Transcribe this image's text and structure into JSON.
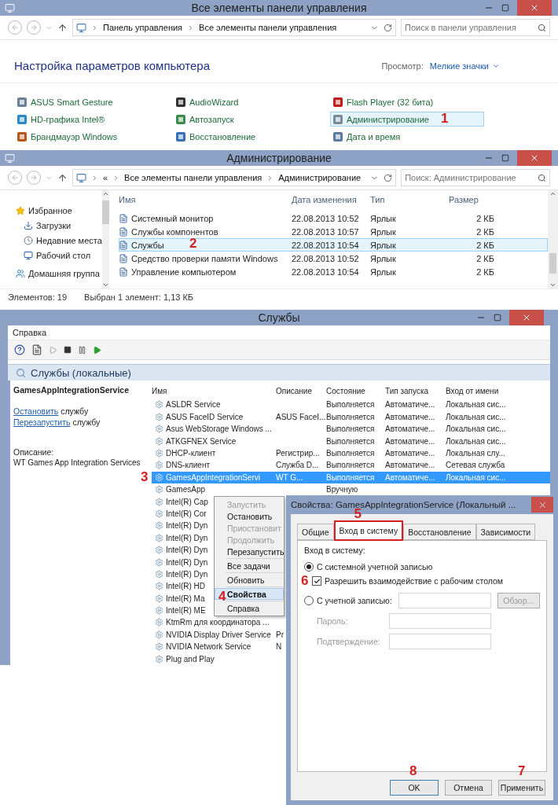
{
  "control_panel": {
    "title": "Все элементы панели управления",
    "breadcrumb": [
      "Панель управления",
      "Все элементы панели управления"
    ],
    "search_placeholder": "Поиск в панели управления",
    "heading": "Настройка параметров компьютера",
    "view_label": "Просмотр:",
    "view_value": "Мелкие значки",
    "items": [
      {
        "label": "ASUS Smart Gesture",
        "selected": false
      },
      {
        "label": "AudioWizard",
        "selected": false
      },
      {
        "label": "Flash Player (32 бита)",
        "selected": false
      },
      {
        "label": "HD-графика Intel®",
        "selected": false
      },
      {
        "label": "Автозапуск",
        "selected": false
      },
      {
        "label": "Администрирование",
        "selected": true,
        "marker": "1"
      },
      {
        "label": "Брандмауэр Windows",
        "selected": false
      },
      {
        "label": "Восстановление",
        "selected": false
      },
      {
        "label": "Дата и время",
        "selected": false
      }
    ]
  },
  "administration": {
    "title": "Администрирование",
    "breadcrumb": [
      "«",
      "Все элементы панели управления",
      "Администрирование"
    ],
    "search_placeholder": "Поиск: Администрирование",
    "nav": [
      {
        "label": "Избранное",
        "kind": "group"
      },
      {
        "label": "Загрузки",
        "kind": "item"
      },
      {
        "label": "Недавние места",
        "kind": "item"
      },
      {
        "label": "Рабочий стол",
        "kind": "item"
      },
      {
        "label": "Домашняя группа",
        "kind": "group"
      }
    ],
    "columns": [
      "Имя",
      "Дата изменения",
      "Тип",
      "Размер"
    ],
    "rows": [
      {
        "name": "Системный монитор",
        "date": "22.08.2013 10:52",
        "type": "Ярлык",
        "size": "2 КБ",
        "selected": false
      },
      {
        "name": "Службы компонентов",
        "date": "22.08.2013 10:57",
        "type": "Ярлык",
        "size": "2 КБ",
        "selected": false
      },
      {
        "name": "Службы",
        "date": "22.08.2013 10:54",
        "type": "Ярлык",
        "size": "2 КБ",
        "selected": true,
        "marker": "2"
      },
      {
        "name": "Средство проверки памяти Windows",
        "date": "22.08.2013 10:52",
        "type": "Ярлык",
        "size": "2 КБ",
        "selected": false
      },
      {
        "name": "Управление компьютером",
        "date": "22.08.2013 10:54",
        "type": "Ярлык",
        "size": "2 КБ",
        "selected": false
      }
    ],
    "status": [
      "Элементов: 19",
      "Выбран 1 элемент: 1,13 КБ"
    ]
  },
  "services": {
    "title": "Службы",
    "menu": [
      "Справка"
    ],
    "scope": "Службы (локальные)",
    "selected_service": "GamesAppIntegrationService",
    "actions": [
      {
        "link": "Остановить",
        "rest": "службу"
      },
      {
        "link": "Перезапустить",
        "rest": "службу"
      }
    ],
    "description_label": "Описание:",
    "description": "WT Games App Integration Services",
    "columns": [
      "Имя",
      "Описание",
      "Состояние",
      "Тип запуска",
      "Вход от имени"
    ],
    "rows": [
      {
        "name": "ASLDR Service",
        "state": "Выполняется",
        "startup": "Автоматиче...",
        "logon": "Локальная сис...",
        "selected": false
      },
      {
        "name": "ASUS FaceID Service",
        "description": "ASUS FaceI...",
        "state": "Выполняется",
        "startup": "Автоматиче...",
        "logon": "Локальная сис...",
        "selected": false
      },
      {
        "name": "Asus WebStorage Windows ...",
        "state": "Выполняется",
        "startup": "Автоматиче...",
        "logon": "Локальная сис...",
        "selected": false
      },
      {
        "name": "ATKGFNEX Service",
        "state": "Выполняется",
        "startup": "Автоматиче...",
        "logon": "Локальная сис...",
        "selected": false
      },
      {
        "name": "DHCP-клиент",
        "description": "Регистрир...",
        "state": "Выполняется",
        "startup": "Автоматиче...",
        "logon": "Локальная слу...",
        "selected": false
      },
      {
        "name": "DNS-клиент",
        "description": "Служба D...",
        "state": "Выполняется",
        "startup": "Автоматиче...",
        "logon": "Сетевая служба",
        "selected": false
      },
      {
        "name": "GamesAppIntegrationServi",
        "description": "WT G...",
        "state": "Выполняется",
        "startup": "Автоматиче...",
        "logon": "Локальная сис...",
        "selected": true,
        "marker": "3"
      },
      {
        "name": "GamesApp",
        "state": "Вручную",
        "selected": false
      },
      {
        "name": "Intel(R) Cap",
        "selected": false
      },
      {
        "name": "Intel(R) Cor",
        "selected": false
      },
      {
        "name": "Intel(R) Dyn",
        "selected": false
      },
      {
        "name": "Intel(R) Dyn",
        "selected": false
      },
      {
        "name": "Intel(R) Dyn",
        "selected": false
      },
      {
        "name": "Intel(R) Dyn",
        "selected": false
      },
      {
        "name": "Intel(R) Dyn",
        "selected": false
      },
      {
        "name": "Intel(R) HD",
        "selected": false
      },
      {
        "name": "Intel(R) Ma",
        "selected": false
      },
      {
        "name": "Intel(R) ME",
        "selected": false
      },
      {
        "name": "KtmRm для координатора ...",
        "selected": false
      },
      {
        "name": "NVIDIA Display Driver Service",
        "description": "Pr",
        "selected": false
      },
      {
        "name": "NVIDIA Network Service",
        "description": "N",
        "selected": false
      },
      {
        "name": "Plug and Play",
        "selected": false
      }
    ]
  },
  "context_menu": [
    {
      "label": "Запустить",
      "disabled": true,
      "selected": false,
      "separator_after": false
    },
    {
      "label": "Остановить",
      "disabled": false,
      "selected": false,
      "separator_after": false
    },
    {
      "label": "Приостановит",
      "disabled": true,
      "selected": false,
      "separator_after": false
    },
    {
      "label": "Продолжить",
      "disabled": true,
      "selected": false,
      "separator_after": false
    },
    {
      "label": "Перезапустить",
      "disabled": false,
      "selected": false,
      "separator_after": true
    },
    {
      "label": "Все задачи",
      "disabled": false,
      "selected": false,
      "separator_after": true
    },
    {
      "label": "Обновить",
      "disabled": false,
      "selected": false,
      "separator_after": true
    },
    {
      "label": "Свойства",
      "disabled": false,
      "selected": true,
      "separator_after": true,
      "marker": "4"
    },
    {
      "label": "Справка",
      "disabled": false,
      "selected": false,
      "separator_after": false
    }
  ],
  "properties_dialog": {
    "title": "Свойства: GamesAppIntegrationService (Локальный ...",
    "tabs": [
      {
        "label": "Общие",
        "selected": false
      },
      {
        "label": "Вход в систему",
        "selected": true,
        "marker": "5"
      },
      {
        "label": "Восстановление",
        "selected": false
      },
      {
        "label": "Зависимости",
        "selected": false
      }
    ],
    "group_label": "Вход в систему:",
    "system_account": {
      "label": "С системной учетной записью",
      "selected": true
    },
    "desktop_interaction": {
      "label": "Разрешить взаимодействие с рабочим столом",
      "checked": true,
      "marker": "6"
    },
    "this_account": {
      "label": "С учетной записью:",
      "selected": false
    },
    "browse": {
      "label": "Обзор...",
      "disabled": true
    },
    "password": {
      "label": "Пароль:",
      "disabled": true
    },
    "confirm": {
      "label": "Подтверждение:",
      "disabled": true
    },
    "buttons": [
      {
        "label": "OK",
        "kind": "default",
        "marker": "8"
      },
      {
        "label": "Отмена",
        "kind": "normal"
      },
      {
        "label": "Применить",
        "kind": "normal",
        "marker": "7"
      }
    ]
  }
}
